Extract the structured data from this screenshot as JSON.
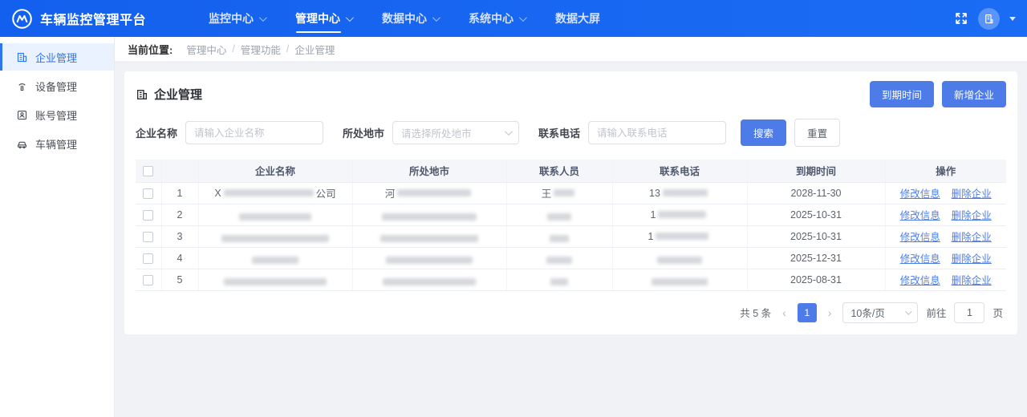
{
  "navbar": {
    "title": "车辆监控管理平台",
    "items": [
      {
        "label": "监控中心",
        "caret": true,
        "active": false
      },
      {
        "label": "管理中心",
        "caret": true,
        "active": true
      },
      {
        "label": "数据中心",
        "caret": true,
        "active": false
      },
      {
        "label": "系统中心",
        "caret": true,
        "active": false
      },
      {
        "label": "数据大屏",
        "caret": false,
        "active": false
      }
    ]
  },
  "sidebar": {
    "items": [
      {
        "label": "企业管理",
        "icon": "building-icon",
        "active": true
      },
      {
        "label": "设备管理",
        "icon": "device-icon",
        "active": false
      },
      {
        "label": "账号管理",
        "icon": "account-icon",
        "active": false
      },
      {
        "label": "车辆管理",
        "icon": "car-icon",
        "active": false
      }
    ]
  },
  "breadcrumb": {
    "label": "当前位置:",
    "items": [
      "管理中心",
      "管理功能",
      "企业管理"
    ],
    "separator": "/"
  },
  "panel": {
    "title": "企业管理",
    "expire_button": "到期时间",
    "add_button": "新增企业",
    "filters": {
      "name_label": "企业名称",
      "name_placeholder": "请输入企业名称",
      "city_label": "所处地市",
      "city_placeholder": "请选择所处地市",
      "phone_label": "联系电话",
      "phone_placeholder": "请输入联系电话",
      "search_button": "搜索",
      "reset_button": "重置"
    }
  },
  "table": {
    "headers": [
      "企业名称",
      "所处地市",
      "联系人员",
      "联系电话",
      "到期时间",
      "操作"
    ],
    "action_edit": "修改信息",
    "action_delete": "删除企业",
    "rows": [
      {
        "index": "1",
        "name": {
          "pre": "X",
          "blur": 112,
          "post": "公司"
        },
        "city": {
          "pre": "河",
          "blur": 92,
          "post": ""
        },
        "person": {
          "pre": "王",
          "blur": 26,
          "post": ""
        },
        "phone": {
          "pre": "13",
          "blur": 56,
          "post": ""
        },
        "date": "2028-11-30"
      },
      {
        "index": "2",
        "name": {
          "pre": "",
          "blur": 90,
          "post": ""
        },
        "city": {
          "pre": "",
          "blur": 118,
          "post": ""
        },
        "person": {
          "pre": "",
          "blur": 30,
          "post": ""
        },
        "phone": {
          "pre": "1",
          "blur": 60,
          "post": ""
        },
        "date": "2025-10-31"
      },
      {
        "index": "3",
        "name": {
          "pre": "",
          "blur": 134,
          "post": ""
        },
        "city": {
          "pre": "",
          "blur": 122,
          "post": ""
        },
        "person": {
          "pre": "",
          "blur": 24,
          "post": ""
        },
        "phone": {
          "pre": "1",
          "blur": 66,
          "post": ""
        },
        "date": "2025-10-31"
      },
      {
        "index": "4",
        "name": {
          "pre": "",
          "blur": 58,
          "post": ""
        },
        "city": {
          "pre": "",
          "blur": 108,
          "post": ""
        },
        "person": {
          "pre": "",
          "blur": 32,
          "post": ""
        },
        "phone": {
          "pre": "",
          "blur": 56,
          "post": ""
        },
        "date": "2025-12-31"
      },
      {
        "index": "5",
        "name": {
          "pre": "",
          "blur": 128,
          "post": ""
        },
        "city": {
          "pre": "",
          "blur": 116,
          "post": ""
        },
        "person": {
          "pre": "",
          "blur": 22,
          "post": ""
        },
        "phone": {
          "pre": "",
          "blur": 70,
          "post": ""
        },
        "date": "2025-08-31"
      }
    ]
  },
  "pagination": {
    "total": "共 5 条",
    "prev": "‹",
    "page": "1",
    "next": "›",
    "page_size": "10条/页",
    "goto_label": "前往",
    "goto_value": "1",
    "goto_suffix": "页"
  },
  "colors": {
    "navbar_blue": "#1766f0",
    "primary_blue": "#4d7ce8",
    "link_blue": "#4c7de6",
    "sidebar_active_bg": "#e9f2fe",
    "sidebar_active_text": "#2e74ec",
    "table_header_bg": "#f5f6fa",
    "page_bg": "#f0f2f5"
  }
}
